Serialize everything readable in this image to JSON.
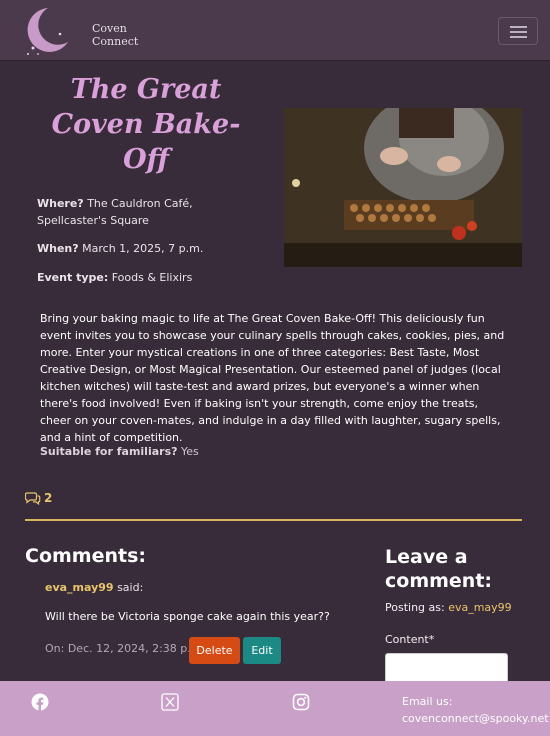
{
  "navbar": {
    "logo_line1": "Coven",
    "logo_line2": "Connect"
  },
  "event": {
    "title": "The Great Coven Bake-Off",
    "where_label": "Where?",
    "where_value": "The Cauldron Café, Spellcaster's Square",
    "when_label": "When?",
    "when_value": "March 1, 2025, 7 p.m.",
    "type_label": "Event type:",
    "type_value": "Foods & Elixirs",
    "description": "Bring your baking magic to life at The Great Coven Bake-Off! This deliciously fun event invites you to showcase your culinary spells through cakes, cookies, pies, and more. Enter your mystical creations in one of three categories: Best Taste, Most Creative Design, or Most Magical Presentation. Our esteemed panel of judges (local kitchen witches) will taste-test and award prizes, but everyone's a winner when there's food involved! Even if baking isn't your strength, come enjoy the treats, cheer on your coven-mates, and indulge in a day filled with laughter, sugary spells, and a hint of competition.",
    "familiars_label": "Suitable for familiars?",
    "familiars_value": "Yes",
    "comment_count": "2"
  },
  "comments": {
    "heading": "Comments:",
    "items": [
      {
        "author": "eva_may99",
        "said": "said:",
        "body": "Will there be Victoria sponge cake again this year??",
        "date": "On: Dec. 12, 2024, 2:38 p.m.",
        "delete_label": "Delete",
        "edit_label": "Edit"
      }
    ]
  },
  "comment_form": {
    "heading": "Leave a comment:",
    "posting_as_label": "Posting as:",
    "posting_as_user": "eva_may99",
    "content_label": "Content*"
  },
  "footer": {
    "email_label": "Email us:",
    "email": "covenconnect@spooky.net"
  },
  "colors": {
    "background": "#392c3a",
    "navbar": "#4a3a4b",
    "title": "#d9a0d9",
    "accent_gold": "#e8c56a",
    "delete_button": "#d64a14",
    "edit_button": "#1b8a84",
    "footer": "#c8a0c8"
  },
  "icons": [
    "moon-logo-icon",
    "hamburger-icon",
    "comments-icon",
    "facebook-icon",
    "x-twitter-icon",
    "instagram-icon"
  ]
}
